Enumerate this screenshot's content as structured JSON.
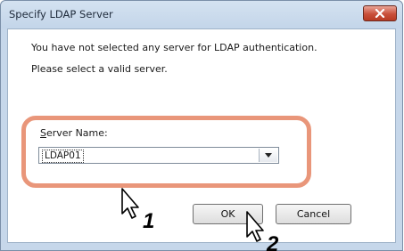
{
  "dialog": {
    "title": "Specify LDAP Server",
    "message_line1": "You have not selected any server for LDAP authentication.",
    "message_line2": "Please select a valid server.",
    "server_name_label_accel": "S",
    "server_name_label_rest": "erver Name:",
    "server_name_value": "LDAP01",
    "ok_label": "OK",
    "cancel_label": "Cancel"
  },
  "annotations": {
    "step1": "1",
    "step2": "2"
  },
  "colors": {
    "highlight": "#e9967a",
    "close_button": "#c9503a"
  }
}
